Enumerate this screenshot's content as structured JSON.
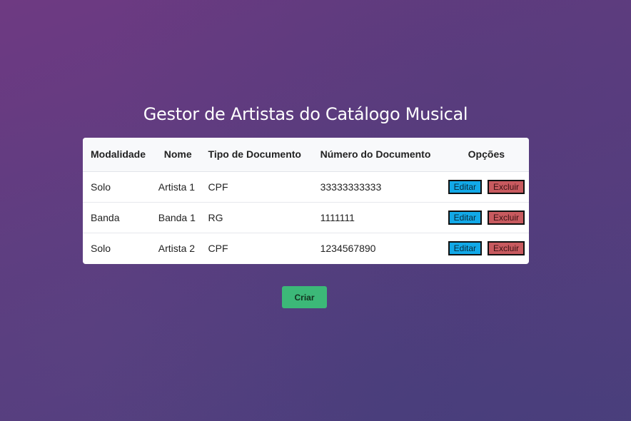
{
  "page": {
    "title": "Gestor de Artistas do Catálogo Musical"
  },
  "table": {
    "headers": {
      "modalidade": "Modalidade",
      "nome": "Nome",
      "tipo_documento": "Tipo de Documento",
      "numero_documento": "Número do Documento",
      "opcoes": "Opções"
    },
    "rows": [
      {
        "modalidade": "Solo",
        "nome": "Artista 1",
        "tipo_documento": "CPF",
        "numero_documento": "33333333333",
        "edit_label": "Editar",
        "delete_label": "Excluir"
      },
      {
        "modalidade": "Banda",
        "nome": "Banda 1",
        "tipo_documento": "RG",
        "numero_documento": "1111111",
        "edit_label": "Editar",
        "delete_label": "Excluir"
      },
      {
        "modalidade": "Solo",
        "nome": "Artista 2",
        "tipo_documento": "CPF",
        "numero_documento": "1234567890",
        "edit_label": "Editar",
        "delete_label": "Excluir"
      }
    ]
  },
  "actions": {
    "create_label": "Criar"
  },
  "colors": {
    "background_start": "#6e3a82",
    "background_end": "#4a3f7c",
    "edit_button": "#12a9e8",
    "delete_button": "#c85a5f",
    "create_button": "#3cb878"
  }
}
